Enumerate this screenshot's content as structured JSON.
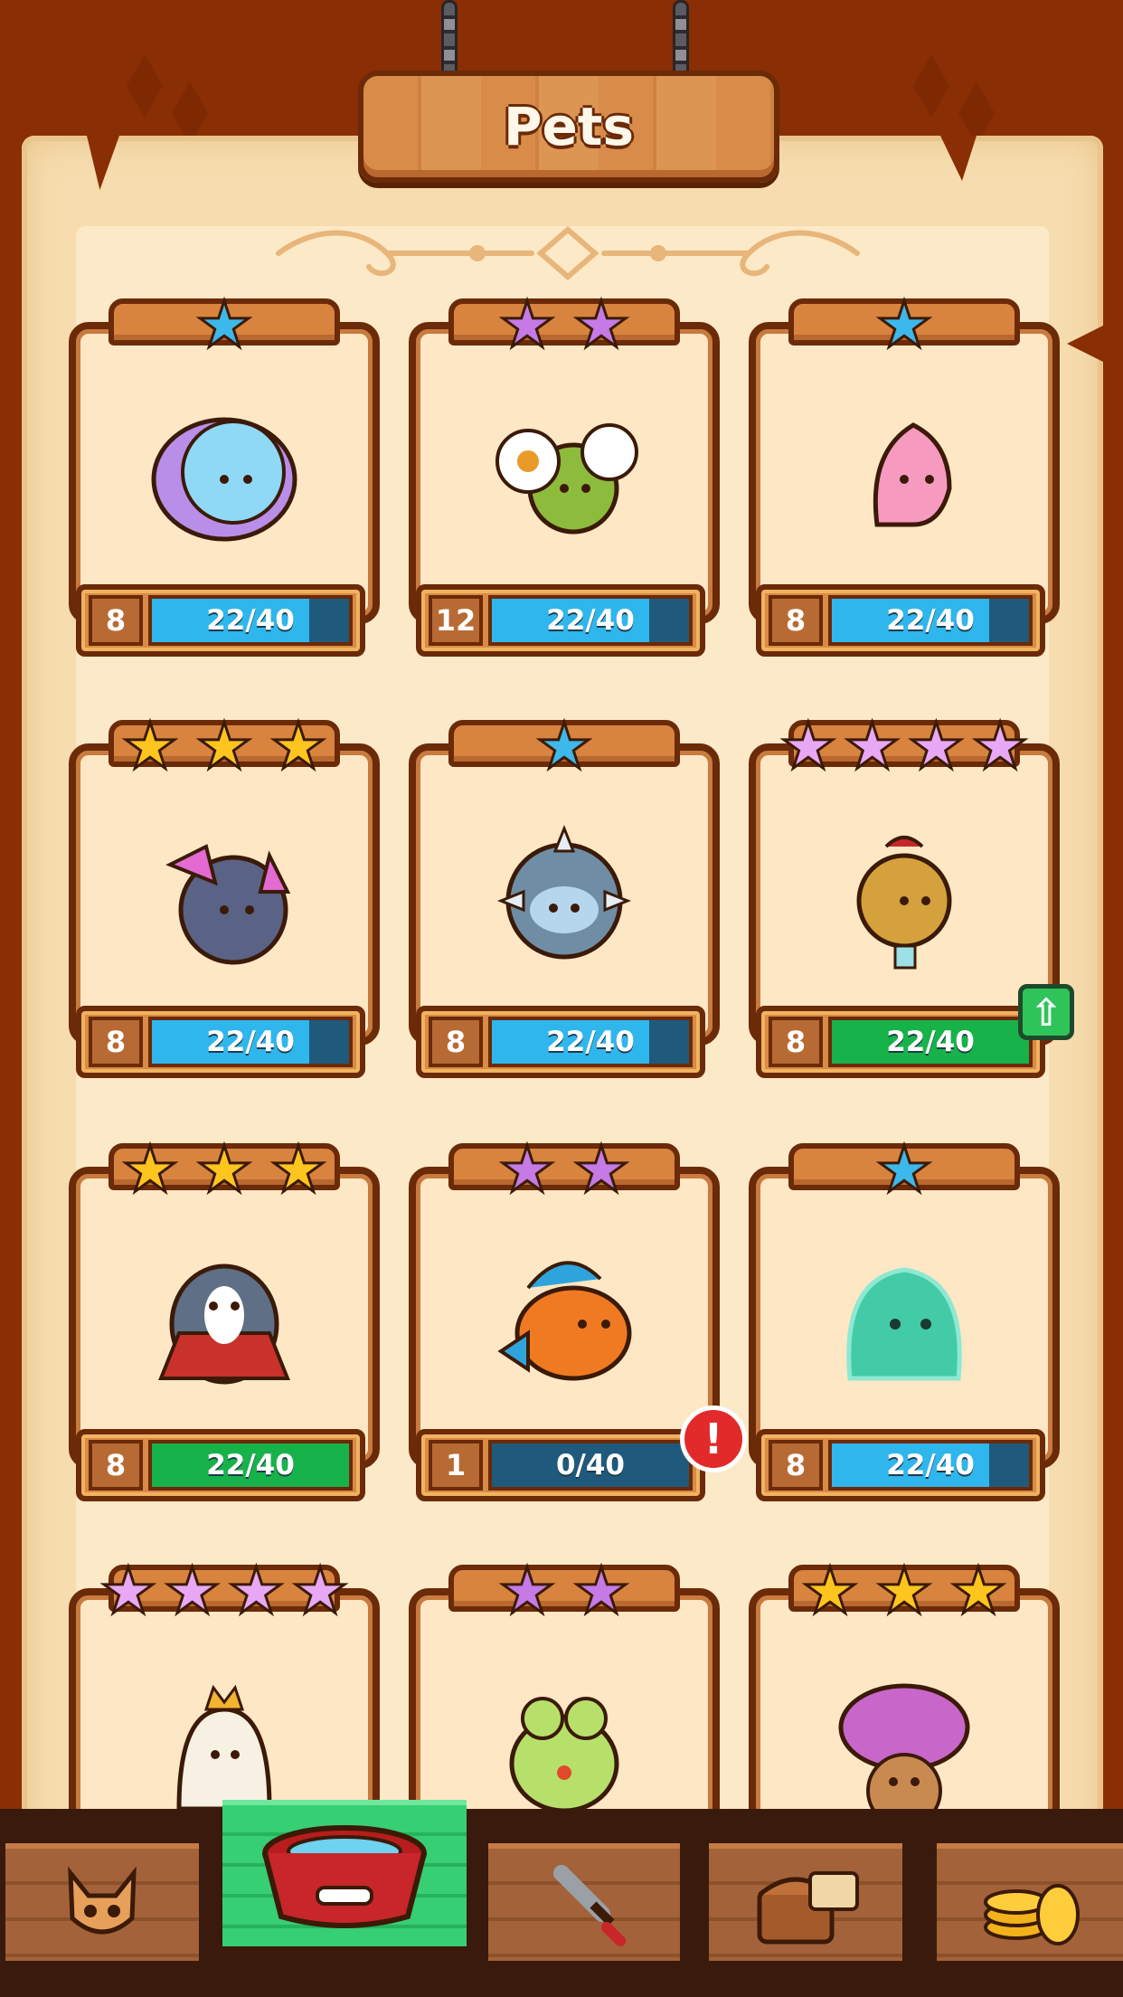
{
  "title": "Pets",
  "colors": {
    "wood": "#8a2e05",
    "parchment": "#f6dcae",
    "progress_blue": "#2fb6ec",
    "progress_green": "#18b24a",
    "alert_red": "#e22a2a"
  },
  "pets": [
    {
      "stars": 1,
      "star_color": "blue",
      "level": "8",
      "progress": "22/40",
      "progress_fraction": 0.55,
      "bar_color": "blue",
      "icon": "cosmic-blob-icon",
      "badge": ""
    },
    {
      "stars": 2,
      "star_color": "purple",
      "level": "12",
      "progress": "22/40",
      "progress_fraction": 0.55,
      "bar_color": "blue",
      "icon": "flower-turtle-icon",
      "badge": ""
    },
    {
      "stars": 1,
      "star_color": "blue",
      "level": "8",
      "progress": "22/40",
      "progress_fraction": 0.55,
      "bar_color": "blue",
      "icon": "pink-genie-icon",
      "badge": ""
    },
    {
      "stars": 3,
      "star_color": "gold",
      "level": "8",
      "progress": "22/40",
      "progress_fraction": 0.55,
      "bar_color": "blue",
      "icon": "crystal-rock-icon",
      "badge": ""
    },
    {
      "stars": 1,
      "star_color": "blue",
      "level": "8",
      "progress": "22/40",
      "progress_fraction": 0.55,
      "bar_color": "blue",
      "icon": "spiky-ball-icon",
      "badge": ""
    },
    {
      "stars": 4,
      "star_color": "pink",
      "level": "8",
      "progress": "22/40",
      "progress_fraction": 0.55,
      "bar_color": "green",
      "icon": "bell-creature-icon",
      "badge": "upgrade"
    },
    {
      "stars": 3,
      "star_color": "gold",
      "level": "8",
      "progress": "22/40",
      "progress_fraction": 0.55,
      "bar_color": "green",
      "icon": "caped-penguin-icon",
      "badge": ""
    },
    {
      "stars": 2,
      "star_color": "purple",
      "level": "1",
      "progress": "0/40",
      "progress_fraction": 0.0,
      "bar_color": "blue",
      "icon": "orange-fish-icon",
      "badge": "alert"
    },
    {
      "stars": 1,
      "star_color": "blue",
      "level": "8",
      "progress": "22/40",
      "progress_fraction": 0.55,
      "bar_color": "blue",
      "icon": "green-slime-icon",
      "badge": ""
    },
    {
      "stars": 4,
      "star_color": "pink",
      "level": "",
      "progress": "",
      "progress_fraction": 0.0,
      "bar_color": "blue",
      "icon": "ghost-king-icon",
      "badge": ""
    },
    {
      "stars": 2,
      "star_color": "purple",
      "level": "",
      "progress": "",
      "progress_fraction": 0.0,
      "bar_color": "blue",
      "icon": "frog-icon",
      "badge": ""
    },
    {
      "stars": 3,
      "star_color": "gold",
      "level": "",
      "progress": "",
      "progress_fraction": 0.0,
      "bar_color": "blue",
      "icon": "flower-hat-icon",
      "badge": ""
    }
  ],
  "nav": [
    {
      "icon": "cat-icon",
      "active": false
    },
    {
      "icon": "pet-bowl-icon",
      "active": true
    },
    {
      "icon": "sword-icon",
      "active": false
    },
    {
      "icon": "treasure-chest-icon",
      "active": false
    },
    {
      "icon": "coins-icon",
      "active": false
    }
  ]
}
